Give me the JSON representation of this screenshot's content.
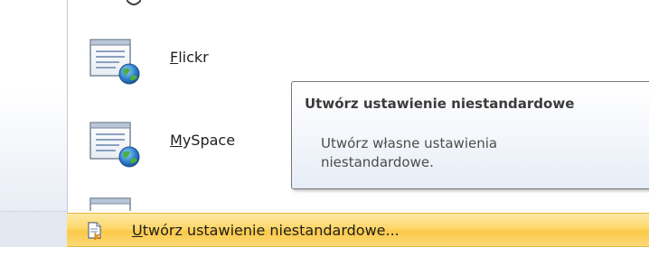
{
  "gallery": {
    "items": [
      {
        "label_prefix": "",
        "label_accel": "F",
        "label_rest": "lickr"
      },
      {
        "label_prefix": "",
        "label_accel": "M",
        "label_rest": "ySpace"
      }
    ]
  },
  "tooltip": {
    "title": "Utwórz ustawienie niestandardowe",
    "body": "Utwórz własne ustawienia niestandardowe."
  },
  "command": {
    "label_accel": "U",
    "label_rest": "twórz ustawienie niestandardowe..."
  },
  "icons": {
    "gallery_thumb": "web-page-globe-icon",
    "command": "custom-page-icon"
  },
  "colors": {
    "highlight": "#fdd76a",
    "tooltip_border": "#767676",
    "globe": "#2e7fc9"
  }
}
